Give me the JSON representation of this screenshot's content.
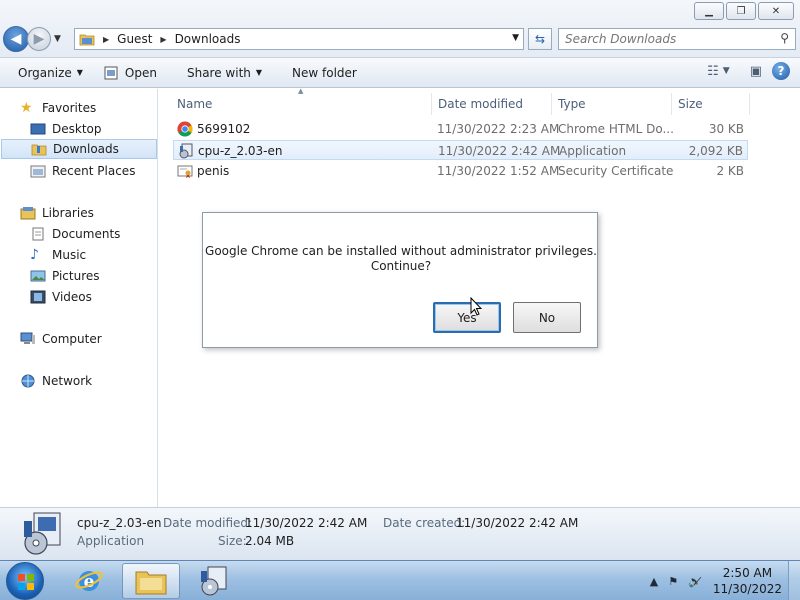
{
  "window": {
    "caption_buttons": [
      "minimize",
      "maximize",
      "close"
    ]
  },
  "address_bar": {
    "crumbs": [
      "Guest",
      "Downloads"
    ]
  },
  "search": {
    "placeholder": "Search Downloads"
  },
  "toolbar": {
    "organize": "Organize",
    "open": "Open",
    "share_with": "Share with",
    "new_folder": "New folder"
  },
  "nav": {
    "favorites": "Favorites",
    "desktop": "Desktop",
    "downloads": "Downloads",
    "recent_places": "Recent Places",
    "libraries": "Libraries",
    "documents": "Documents",
    "music": "Music",
    "pictures": "Pictures",
    "videos": "Videos",
    "computer": "Computer",
    "network": "Network"
  },
  "columns": {
    "name": "Name",
    "date_modified": "Date modified",
    "type": "Type",
    "size": "Size"
  },
  "files": [
    {
      "name": "5699102",
      "date": "11/30/2022 2:23 AM",
      "type": "Chrome HTML Do...",
      "size": "30 KB",
      "icon": "chrome-icon"
    },
    {
      "name": "cpu-z_2.03-en",
      "date": "11/30/2022 2:42 AM",
      "type": "Application",
      "size": "2,092 KB",
      "icon": "installer-icon"
    },
    {
      "name": "penis",
      "date": "11/30/2022 1:52 AM",
      "type": "Security Certificate",
      "size": "2 KB",
      "icon": "certificate-icon"
    }
  ],
  "details": {
    "name": "cpu-z_2.03-en",
    "kind": "Application",
    "date_modified_label": "Date modified:",
    "date_modified": "11/30/2022 2:42 AM",
    "size_label": "Size:",
    "size": "2.04 MB",
    "date_created_label": "Date created:",
    "date_created": "11/30/2022 2:42 AM"
  },
  "dialog": {
    "message_line1": "Google Chrome can be installed without administrator privileges.",
    "message_line2": "Continue?",
    "yes": "Yes",
    "no": "No"
  },
  "taskbar": {
    "time": "2:50 AM",
    "date": "11/30/2022"
  },
  "colors": {
    "accent": "#2b6bb0",
    "selection": "#d3e4f8"
  }
}
